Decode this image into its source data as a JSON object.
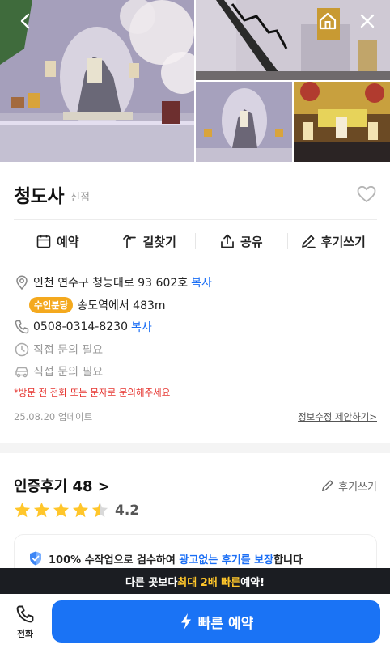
{
  "header": {
    "back_icon": "chevron-left-icon",
    "home_icon": "home-icon",
    "close_icon": "close-icon"
  },
  "gallery": {
    "photos": [
      "temple-interior-main",
      "temple-staircase",
      "temple-shrine-statue",
      "temple-golden-altar"
    ]
  },
  "place": {
    "name": "청도사",
    "badge": "신점"
  },
  "actions": [
    {
      "label": "예약",
      "icon": "calendar-icon"
    },
    {
      "label": "길찾기",
      "icon": "turn-arrow-icon"
    },
    {
      "label": "공유",
      "icon": "share-icon"
    },
    {
      "label": "후기쓰기",
      "icon": "pencil-icon"
    }
  ],
  "info": {
    "address": "인천 연수구 청능대로 93 602호",
    "copy_label": "복사",
    "line_badge": "수인분당",
    "station": "송도역에서 483m",
    "phone": "0508-0314-8230",
    "hours": "직접 문의 필요",
    "parking": "직접 문의 필요",
    "notice": "*방문 전 전화 또는 문자로 문의해주세요",
    "updated": "25.08.20 업데이트",
    "suggest": "정보수정 제안하기>"
  },
  "reviews": {
    "title": "인증후기 48 >",
    "write": "후기쓰기",
    "rating": "4.2",
    "stars": 4.2
  },
  "promo": {
    "text_a": "100% 수작업으로 검수하여 ",
    "text_b": "광고없는 후기를 보장",
    "text_c": "합니다"
  },
  "bottom": {
    "strip_a": "다른 곳보다 ",
    "strip_b": "최대 2배 빠른",
    "strip_c": " 예약!",
    "call_label": "전화",
    "book_label": "빠른 예약"
  },
  "colors": {
    "accent": "#1a73f5",
    "star": "#ffc62b",
    "line_badge": "#f4a91e",
    "notice": "#e5322d"
  }
}
